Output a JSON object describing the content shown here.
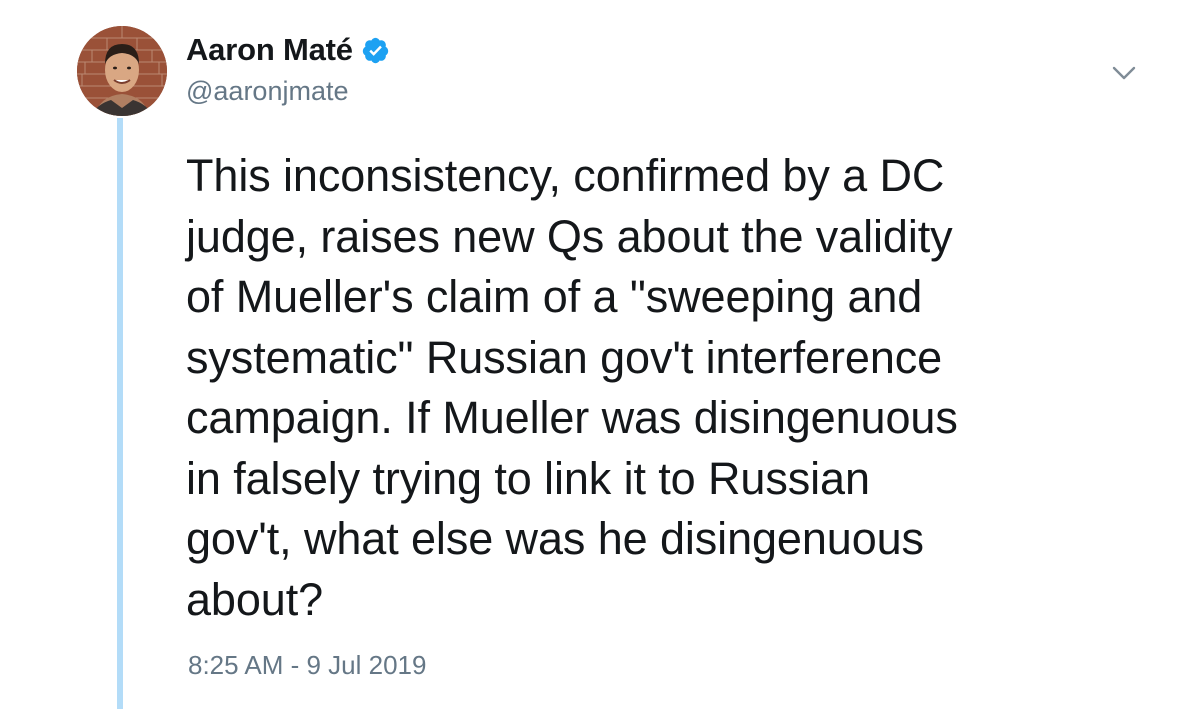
{
  "author": {
    "display_name": "Aaron Maté",
    "handle": "@aaronjmate",
    "verified": true
  },
  "icons": {
    "verified": "verified-badge-icon",
    "menu": "chevron-down-icon",
    "avatar": "profile-photo"
  },
  "tweet": {
    "text": "This inconsistency, confirmed by a DC\njudge, raises new Qs about the validity\nof Mueller's claim of a \"sweeping and\nsystematic\" Russian gov't interference\ncampaign. If Mueller was disingenuous\nin falsely trying to link it to Russian\ngov't, what else was he disingenuous\nabout?",
    "timestamp": "8:25 AM - 9 Jul 2019"
  },
  "colors": {
    "verified_blue": "#1da1f2",
    "thread_line": "#b3dcf8",
    "text_primary": "#14171a",
    "text_secondary": "#657786"
  }
}
